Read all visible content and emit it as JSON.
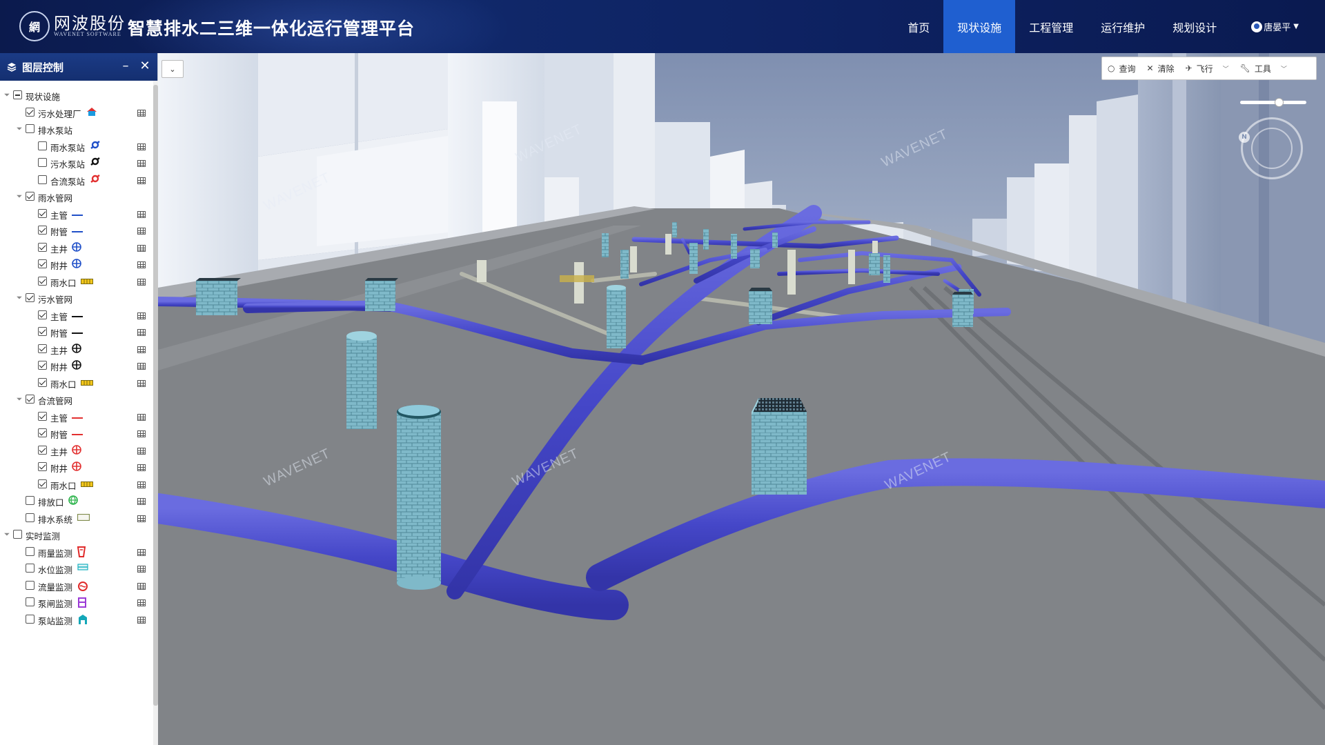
{
  "header": {
    "company_name": "网波股份",
    "company_en": "WAVENET  SOFTWARE",
    "logo_mark": "網",
    "app_title": "智慧排水二三维一体化运行管理平台",
    "nav": [
      {
        "label": "首页",
        "active": false
      },
      {
        "label": "现状设施",
        "active": true
      },
      {
        "label": "工程管理",
        "active": false
      },
      {
        "label": "运行维护",
        "active": false
      },
      {
        "label": "规划设计",
        "active": false
      }
    ],
    "user_name": "唐晏平"
  },
  "layer_panel": {
    "title": "图层控制",
    "items": [
      {
        "label": "现状设施",
        "level": 0,
        "state": "partial",
        "expand": true,
        "legend": "",
        "table": false
      },
      {
        "label": "污水处理厂",
        "level": 1,
        "state": "checked",
        "expand": false,
        "legend": "plant-icon",
        "table": true
      },
      {
        "label": "排水泵站",
        "level": 1,
        "state": "unchecked",
        "expand": true,
        "legend": "",
        "table": false
      },
      {
        "label": "雨水泵站",
        "level": 2,
        "state": "unchecked",
        "expand": false,
        "legend": "pump-blue-icon",
        "table": true
      },
      {
        "label": "污水泵站",
        "level": 2,
        "state": "unchecked",
        "expand": false,
        "legend": "pump-black-icon",
        "table": true
      },
      {
        "label": "合流泵站",
        "level": 2,
        "state": "unchecked",
        "expand": false,
        "legend": "pump-red-icon",
        "table": true
      },
      {
        "label": "雨水管网",
        "level": 1,
        "state": "checked",
        "expand": true,
        "legend": "",
        "table": false
      },
      {
        "label": "主管",
        "level": 2,
        "state": "checked",
        "expand": false,
        "legend": "line-blue-icon",
        "table": true
      },
      {
        "label": "附管",
        "level": 2,
        "state": "checked",
        "expand": false,
        "legend": "line-blue-icon",
        "table": true
      },
      {
        "label": "主井",
        "level": 2,
        "state": "checked",
        "expand": false,
        "legend": "well-blue-icon",
        "table": true
      },
      {
        "label": "附井",
        "level": 2,
        "state": "checked",
        "expand": false,
        "legend": "well-blue-icon",
        "table": true
      },
      {
        "label": "雨水口",
        "level": 2,
        "state": "checked",
        "expand": false,
        "legend": "inlet-yellow-icon",
        "table": true
      },
      {
        "label": "污水管网",
        "level": 1,
        "state": "checked",
        "expand": true,
        "legend": "",
        "table": false
      },
      {
        "label": "主管",
        "level": 2,
        "state": "checked",
        "expand": false,
        "legend": "line-black-icon",
        "table": true
      },
      {
        "label": "附管",
        "level": 2,
        "state": "checked",
        "expand": false,
        "legend": "line-black-icon",
        "table": true
      },
      {
        "label": "主井",
        "level": 2,
        "state": "checked",
        "expand": false,
        "legend": "well-black-icon",
        "table": true
      },
      {
        "label": "附井",
        "level": 2,
        "state": "checked",
        "expand": false,
        "legend": "well-black-icon",
        "table": true
      },
      {
        "label": "雨水口",
        "level": 2,
        "state": "checked",
        "expand": false,
        "legend": "inlet-yellow-icon",
        "table": true
      },
      {
        "label": "合流管网",
        "level": 1,
        "state": "checked",
        "expand": true,
        "legend": "",
        "table": false
      },
      {
        "label": "主管",
        "level": 2,
        "state": "checked",
        "expand": false,
        "legend": "line-red-icon",
        "table": true
      },
      {
        "label": "附管",
        "level": 2,
        "state": "checked",
        "expand": false,
        "legend": "line-red-icon",
        "table": true
      },
      {
        "label": "主井",
        "level": 2,
        "state": "checked",
        "expand": false,
        "legend": "well-red-icon",
        "table": true
      },
      {
        "label": "附井",
        "level": 2,
        "state": "checked",
        "expand": false,
        "legend": "well-red-icon",
        "table": true
      },
      {
        "label": "雨水口",
        "level": 2,
        "state": "checked",
        "expand": false,
        "legend": "inlet-yellow-icon",
        "table": true
      },
      {
        "label": "排放口",
        "level": 1,
        "state": "unchecked",
        "expand": false,
        "legend": "outfall-green-icon",
        "table": true
      },
      {
        "label": "排水系统",
        "level": 1,
        "state": "unchecked",
        "expand": false,
        "legend": "system-rect-icon",
        "table": true
      },
      {
        "label": "实时监测",
        "level": 0,
        "state": "unchecked",
        "expand": true,
        "legend": "",
        "table": false
      },
      {
        "label": "雨量监测",
        "level": 1,
        "state": "unchecked",
        "expand": false,
        "legend": "rain-gauge-icon",
        "table": true
      },
      {
        "label": "水位监测",
        "level": 1,
        "state": "unchecked",
        "expand": false,
        "legend": "water-level-icon",
        "table": true
      },
      {
        "label": "流量监测",
        "level": 1,
        "state": "unchecked",
        "expand": false,
        "legend": "flow-meter-icon",
        "table": true
      },
      {
        "label": "泵闸监测",
        "level": 1,
        "state": "unchecked",
        "expand": false,
        "legend": "pump-gate-icon",
        "table": true
      },
      {
        "label": "泵站监测",
        "level": 1,
        "state": "unchecked",
        "expand": false,
        "legend": "pump-station-icon",
        "table": true
      }
    ]
  },
  "toolbar": {
    "query": "查询",
    "clear": "清除",
    "fly": "飞行",
    "tools": "工具"
  },
  "watermark": "WAVENET",
  "zoom_level": 0.6,
  "colors": {
    "header": "#0d2160",
    "nav_active": "#1f5fd0",
    "pipe": "#4d4fd1",
    "manhole": "#8fcadb",
    "road": "#7e8184",
    "building": "#d6dde8"
  }
}
